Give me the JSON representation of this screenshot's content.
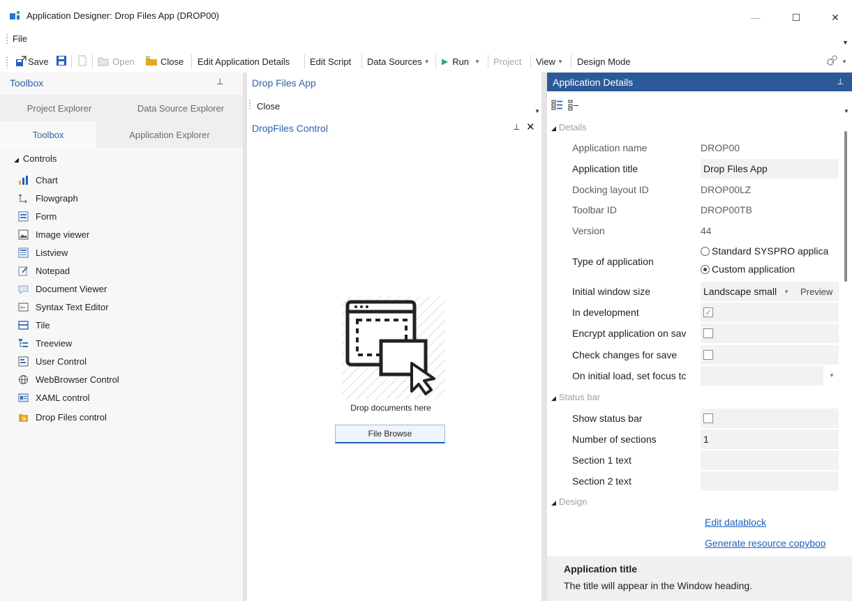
{
  "window": {
    "title": "Application Designer: Drop Files App  (DROP00)",
    "minimize": "—",
    "maximize": "☐",
    "close": "✕"
  },
  "menu": {
    "file": "File"
  },
  "toolbar": {
    "save": "Save",
    "open": "Open",
    "close": "Close",
    "edit_app_details": "Edit Application Details",
    "edit_script": "Edit Script",
    "data_sources": "Data Sources",
    "run": "Run",
    "project": "Project",
    "view": "View",
    "design_mode": "Design Mode"
  },
  "toolbox": {
    "header": "Toolbox",
    "tabs": [
      "Project Explorer",
      "Data Source Explorer",
      "Toolbox",
      "Application Explorer"
    ],
    "group": "Controls",
    "items": [
      {
        "label": "Chart",
        "icon": "chart-icon"
      },
      {
        "label": "Flowgraph",
        "icon": "flowgraph-icon"
      },
      {
        "label": "Form",
        "icon": "form-icon"
      },
      {
        "label": "Image viewer",
        "icon": "image-viewer-icon"
      },
      {
        "label": "Listview",
        "icon": "listview-icon"
      },
      {
        "label": "Notepad",
        "icon": "notepad-icon"
      },
      {
        "label": "Document Viewer",
        "icon": "document-viewer-icon"
      },
      {
        "label": "Syntax Text Editor",
        "icon": "syntax-editor-icon"
      },
      {
        "label": "Tile",
        "icon": "tile-icon"
      },
      {
        "label": "Treeview",
        "icon": "treeview-icon"
      },
      {
        "label": "User Control",
        "icon": "user-control-icon"
      },
      {
        "label": "WebBrowser Control",
        "icon": "globe-icon"
      },
      {
        "label": "XAML control",
        "icon": "xaml-icon"
      },
      {
        "label": "Drop Files control",
        "icon": "drop-files-icon"
      }
    ]
  },
  "center": {
    "header": "Drop Files App",
    "close": "Close",
    "panel_title": "DropFiles Control",
    "pin": "⊥",
    "panel_close": "✕",
    "drop_text": "Drop documents here",
    "browse_button": "File Browse"
  },
  "details": {
    "header": "Application Details",
    "sections": {
      "details": "Details",
      "status_bar": "Status bar",
      "design": "Design"
    },
    "props": {
      "app_name_label": "Application name",
      "app_name_value": "DROP00",
      "app_title_label": "Application title",
      "app_title_value": "Drop Files App",
      "docking_label": "Docking layout ID",
      "docking_value": "DROP00LZ",
      "toolbar_label": "Toolbar ID",
      "toolbar_value": "DROP00TB",
      "version_label": "Version",
      "version_value": "44",
      "type_label": "Type of application",
      "type_option_standard": "Standard SYSPRO applica",
      "type_option_custom": "Custom application",
      "window_size_label": "Initial window size",
      "window_size_value": "Landscape small",
      "preview": "Preview",
      "in_dev_label": "In development",
      "encrypt_label": "Encrypt application on sav",
      "check_changes_label": "Check changes for save",
      "focus_label": "On initial load, set focus tc",
      "show_status_label": "Show status bar",
      "num_sections_label": "Number of sections",
      "num_sections_value": "1",
      "section1_label": "Section 1 text",
      "section2_label": "Section 2 text",
      "edit_datablock": "Edit datablock",
      "generate_resource": "Generate resource copyboo"
    },
    "help": {
      "title": "Application title",
      "desc": "The title will appear in the Window heading."
    }
  },
  "colors": {
    "accent": "#2a62a8",
    "details_header_bg": "#2c5a99",
    "link": "#1f5fbf"
  }
}
